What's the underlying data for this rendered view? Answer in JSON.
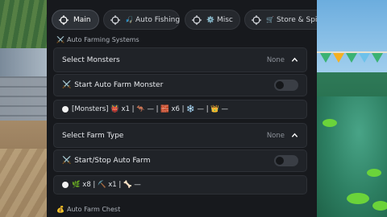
{
  "tabs": [
    {
      "label": "Main",
      "icon": "target-icon",
      "active": true
    },
    {
      "label": "Auto Fishing",
      "icon": "target-icon",
      "sub_emoji": "🎣"
    },
    {
      "label": "Misc",
      "icon": "target-icon",
      "sub_emoji": "⚙️"
    },
    {
      "label": "Store & Spin",
      "icon": "target-icon",
      "sub_emoji": "🛒"
    }
  ],
  "sections": {
    "farming": {
      "emoji": "⚔️",
      "label": "Auto Farming Systems"
    },
    "chest": {
      "emoji": "💰",
      "label": "Auto Farm Chest"
    }
  },
  "select_monsters": {
    "label": "Select Monsters",
    "value": "None"
  },
  "auto_farm_monster": {
    "emoji": "⚔️",
    "label": "Start Auto Farm Monster",
    "enabled": false
  },
  "monsters_info": {
    "text": "[Monsters] 👹 x1 | 🦘 — | 🧱 x6 | ❄️ — | 👑 —"
  },
  "select_farm_type": {
    "label": "Select Farm Type",
    "value": "None"
  },
  "auto_farm": {
    "emoji": "⚔️",
    "label": "Start/Stop Auto Farm",
    "enabled": false
  },
  "farm_info": {
    "text": "🌿 x8 | ⛏️ x1 | 🦴 —"
  },
  "colors": {
    "panel": "#17191d",
    "card": "#202328",
    "toggle_off": "#3a3e45"
  }
}
